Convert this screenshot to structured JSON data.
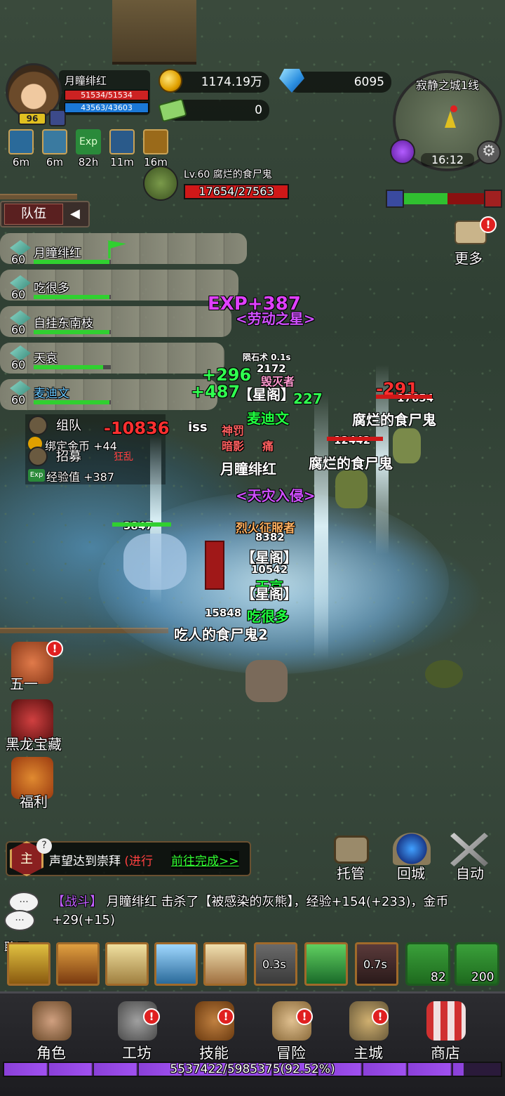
{
  "player": {
    "name": "月瞳绯红",
    "hp": "51534/51534",
    "mp": "43563/43603",
    "level": "96"
  },
  "currency": {
    "gold": "1174.19万",
    "gems": "6095",
    "tickets": "0"
  },
  "buffs": [
    {
      "icon": "bolt-buff-icon",
      "time": "6m"
    },
    {
      "icon": "crystal-buff-icon",
      "time": "6m"
    },
    {
      "icon": "exp-buff-icon",
      "label": "Exp",
      "time": "82h"
    },
    {
      "icon": "eye-buff-icon",
      "time": "11m"
    },
    {
      "icon": "crown-buff-icon",
      "time": "16m"
    }
  ],
  "target": {
    "name": "Lv.60 腐烂的食尸鬼",
    "hp": "17654/27563"
  },
  "minimap": {
    "map_name": "寂静之城1线",
    "time": "16:12"
  },
  "more": {
    "label": "更多"
  },
  "team": {
    "tab_label": "队伍",
    "members": [
      {
        "level": "60",
        "name": "月瞳绯红",
        "hp_fraction": 0.98
      },
      {
        "level": "60",
        "name": "吃很多",
        "hp_fraction": 0.98
      },
      {
        "level": "60",
        "name": "自挂东南枝",
        "hp_fraction": 0.98
      },
      {
        "level": "60",
        "name": "天哀",
        "hp_fraction": 0.9
      },
      {
        "level": "60",
        "name": "麦迪文",
        "hp_fraction": 0.98
      }
    ]
  },
  "side_menu": {
    "recruit_team": "组队",
    "bound_gold": "绑定金币 +44",
    "recruit": "招募",
    "exp_gain": "经验值 +387",
    "exp_tag": "Exp",
    "debuff_text": "狂乱"
  },
  "battle": {
    "exp_float": "EXP+387",
    "title_labor": "<劳动之星>",
    "meteor_cast": "陨石术 0.1s",
    "heal_1": "+296",
    "heal_2": "+487",
    "destroyer": "毁灭者",
    "guild_1": "【星阁】",
    "medivh": "麦迪文",
    "dmg_1": "-10836",
    "miss": "iss",
    "divine": "神罚",
    "shadow": "暗影",
    "pain": "痛",
    "self_name": "月瞳绯红",
    "title_calamity": "<天灾入侵>",
    "fire_conqueror": "烈火征服者",
    "hp_8382": "8382",
    "guild_2": "【星阁】",
    "hp_10542": "10542",
    "tianai": "天哀",
    "guild_3": "【星阁】",
    "eat_many": "吃很多",
    "hp_15848": "15848",
    "ghoul2": "吃人的食尸鬼2",
    "hp_3847": "3847",
    "dmg_2": "-291",
    "enemy1_hp": "17654",
    "enemy1_name": "腐烂的食尸鬼",
    "enemy2_hp": "12442",
    "enemy2_name": "腐烂的食尸鬼",
    "num_2172": "2172",
    "num_227": "227"
  },
  "events": [
    {
      "label": "五一",
      "badge": "!"
    },
    {
      "label": "黑龙宝藏"
    },
    {
      "label": "福利"
    }
  ],
  "quest": {
    "icon_text": "主",
    "text": "声望达到崇拜",
    "status": "(进行",
    "go": "前往完成>>"
  },
  "actions": [
    {
      "label": "托管"
    },
    {
      "label": "回城"
    },
    {
      "label": "自动"
    }
  ],
  "chat": {
    "label": "聊天",
    "bubble_text": "...",
    "channel": "【战斗】",
    "message": " 月瞳绯红  击杀了【被感染的灰熊】，经验+154(+233)，金币+29(+15)"
  },
  "skills": [
    {
      "icon": "lightning-skill-icon"
    },
    {
      "icon": "crown-skill-icon"
    },
    {
      "icon": "shield-skill-icon"
    },
    {
      "icon": "crystal-skill-icon"
    },
    {
      "icon": "burst-skill-icon"
    },
    {
      "icon": "meteor-skill-icon",
      "cooldown": "0.3s"
    },
    {
      "icon": "hand-skill-icon"
    },
    {
      "icon": "dark-skill-icon",
      "cooldown": "0.7s"
    }
  ],
  "potions": [
    {
      "icon": "scroll-potion-icon",
      "count": "82"
    },
    {
      "icon": "food-potion-icon",
      "count": "200"
    }
  ],
  "nav": [
    {
      "label": "角色",
      "badge": false
    },
    {
      "label": "工坊",
      "badge": true
    },
    {
      "label": "技能",
      "badge": true
    },
    {
      "label": "冒险",
      "badge": true
    },
    {
      "label": "主城",
      "badge": true
    },
    {
      "label": "商店",
      "badge": false
    }
  ],
  "xp": {
    "text": "5537422/5985375(92.52%)",
    "fraction": 0.9252
  },
  "colors": {
    "hp": "#c22222",
    "mp": "#1b78d6",
    "exp_bar": "#a050f0",
    "heal": "#30ff50",
    "damage": "#ff3030"
  }
}
